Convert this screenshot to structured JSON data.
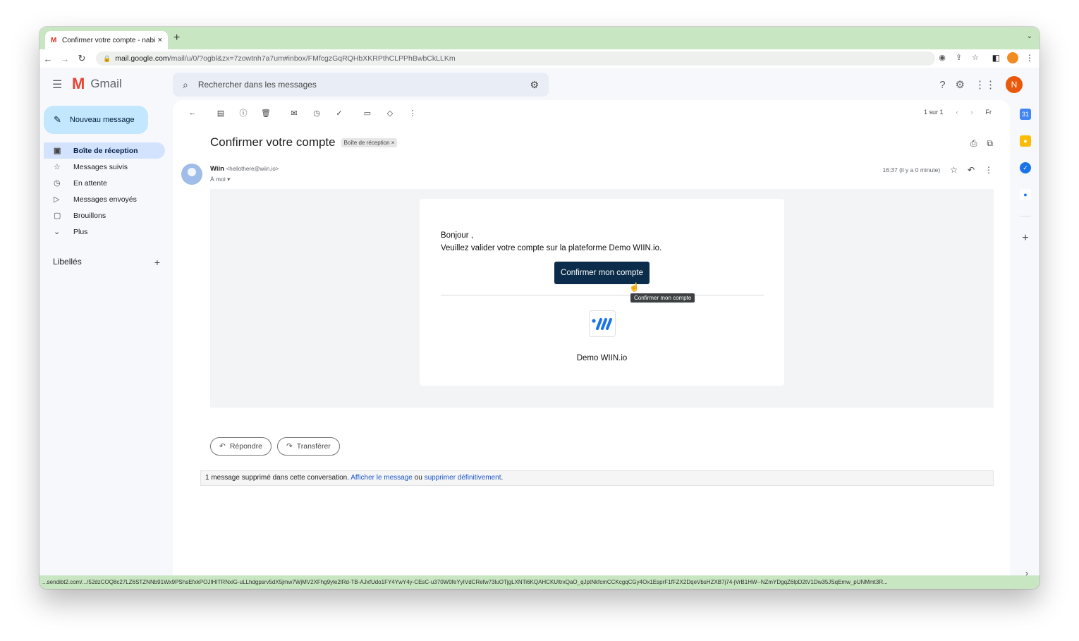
{
  "browser": {
    "tab_title": "Confirmer votre compte - nabi",
    "tab_close": "×",
    "new_tab": "+",
    "url_host": "mail.google.com",
    "url_path": "/mail/u/0/?ogbl&zx=7zowtnh7a7um#inbox/FMfcgzGqRQHbXKRPthCLPPhBwbCkLLKm",
    "status_url": "...sendibt2.com/.../52dzCOQ8c27LZ6STZNNb91Wx9PShsEfxkPOJIHITRNxiG-uLLhdgpsrv5dX5jmw7WjMV2XFhg9yle2lRd-TB-AJxfUdo1FY4YwY4y-CEsC-u370W0feYyIVdCRefw73luOTjgLXNTi6KQAHCKUltrxQaO_qJptNkfcmCCKcgqCGy4Ox1EsprF1fFZX2DqeVbsHZXB7j74-jVrB1HW--NZmYDgqZ6lpD2tV1Dw35JSqEmw_pUNMmt3R..."
  },
  "gmail": {
    "brand": "Gmail",
    "search_placeholder": "Rechercher dans les messages",
    "avatar_initial": "N",
    "compose_label": "Nouveau message",
    "nav": [
      {
        "label": "Boîte de réception",
        "icon": "inbox-icon",
        "active": true
      },
      {
        "label": "Messages suivis",
        "icon": "star-icon"
      },
      {
        "label": "En attente",
        "icon": "clock-icon"
      },
      {
        "label": "Messages envoyés",
        "icon": "send-icon"
      },
      {
        "label": "Brouillons",
        "icon": "draft-icon"
      },
      {
        "label": "Plus",
        "icon": "chevron-down-icon"
      }
    ],
    "labels_heading": "Libellés",
    "pager_text": "1 sur 1",
    "lang_indicator": "Fr"
  },
  "message": {
    "subject": "Confirmer votre compte",
    "label_chip": "Boîte de réception ×",
    "sender_name": "Wiin",
    "sender_email": "<hellothere@wiin.io>",
    "recipient": "À moi",
    "time": "16:37 (il y a 0 minute)",
    "greeting": "Bonjour ,",
    "body": "Veuillez valider votre compte sur la plateforme Demo WIIN.io.",
    "cta_label": "Confirmer mon compte",
    "tooltip": "Confirmer mon compte",
    "brand_name": "Demo WIIN.io"
  },
  "footer": {
    "reply_label": "Répondre",
    "forward_label": "Transférer",
    "deleted_text": "1 message supprimé dans cette conversation.",
    "show_link": "Afficher le message",
    "or_text": "ou",
    "delete_link": "supprimer définitivement"
  },
  "colors": {
    "accent": "#0b2c4a",
    "compose_bg": "#c2e7ff",
    "chrome_green": "#c9e6c2"
  }
}
